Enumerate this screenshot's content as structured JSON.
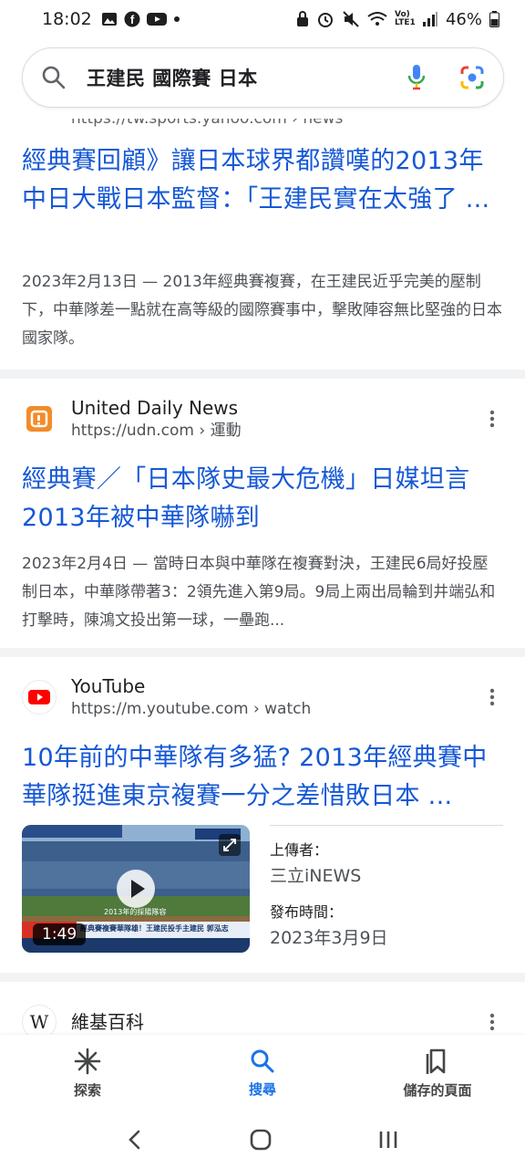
{
  "status": {
    "time": "18:02",
    "battery": "46%",
    "network": "Vo) LTE1"
  },
  "search": {
    "query": "王建民 國際賽 日本"
  },
  "results": {
    "first": {
      "cut_url": "https://tw.sports.yahoo.com › news",
      "title": "經典賽回顧》讓日本球界都讚嘆的2013年中日大戰日本監督：「王建民實在太強了 ...",
      "snippet": "2023年2月13日 — 2013年經典賽複賽，在王建民近乎完美的壓制下，中華隊差一點就在高等級的國際賽事中，擊敗陣容無比堅強的日本國家隊。"
    },
    "udn": {
      "source_name": "United Daily News",
      "source_url": "https://udn.com › 運動",
      "title": "經典賽／「日本隊史最大危機」日媒坦言2013年被中華隊嚇到",
      "snippet": "2023年2月4日 — 當時日本與中華隊在複賽對決，王建民6局好投壓制日本，中華隊帶著3：2領先進入第9局。9局上兩出局輪到井端弘和打擊時，陳鴻文投出第一球，一壘跑..."
    },
    "youtube": {
      "source_name": "YouTube",
      "source_url": "https://m.youtube.com › watch",
      "title": "10年前的中華隊有多猛? 2013年經典賽中華隊挺進東京複賽一分之差惜敗日本 ...",
      "duration": "1:49",
      "thumb_caption": "2013年的採陽隊容",
      "thumb_banner": "經典賽複賽華隊雄！王建民投手主建民 郭泓志",
      "uploader_label": "上傳者：",
      "uploader": "三立iNEWS",
      "date_label": "發布時間：",
      "date": "2023年3月9日"
    },
    "wiki": {
      "source_name": "維基百科",
      "favicon_letter": "W"
    }
  },
  "nav": {
    "explore": "探索",
    "search": "搜尋",
    "saved": "儲存的頁面"
  },
  "colors": {
    "link": "#1558d6",
    "active": "#1a73e8"
  }
}
